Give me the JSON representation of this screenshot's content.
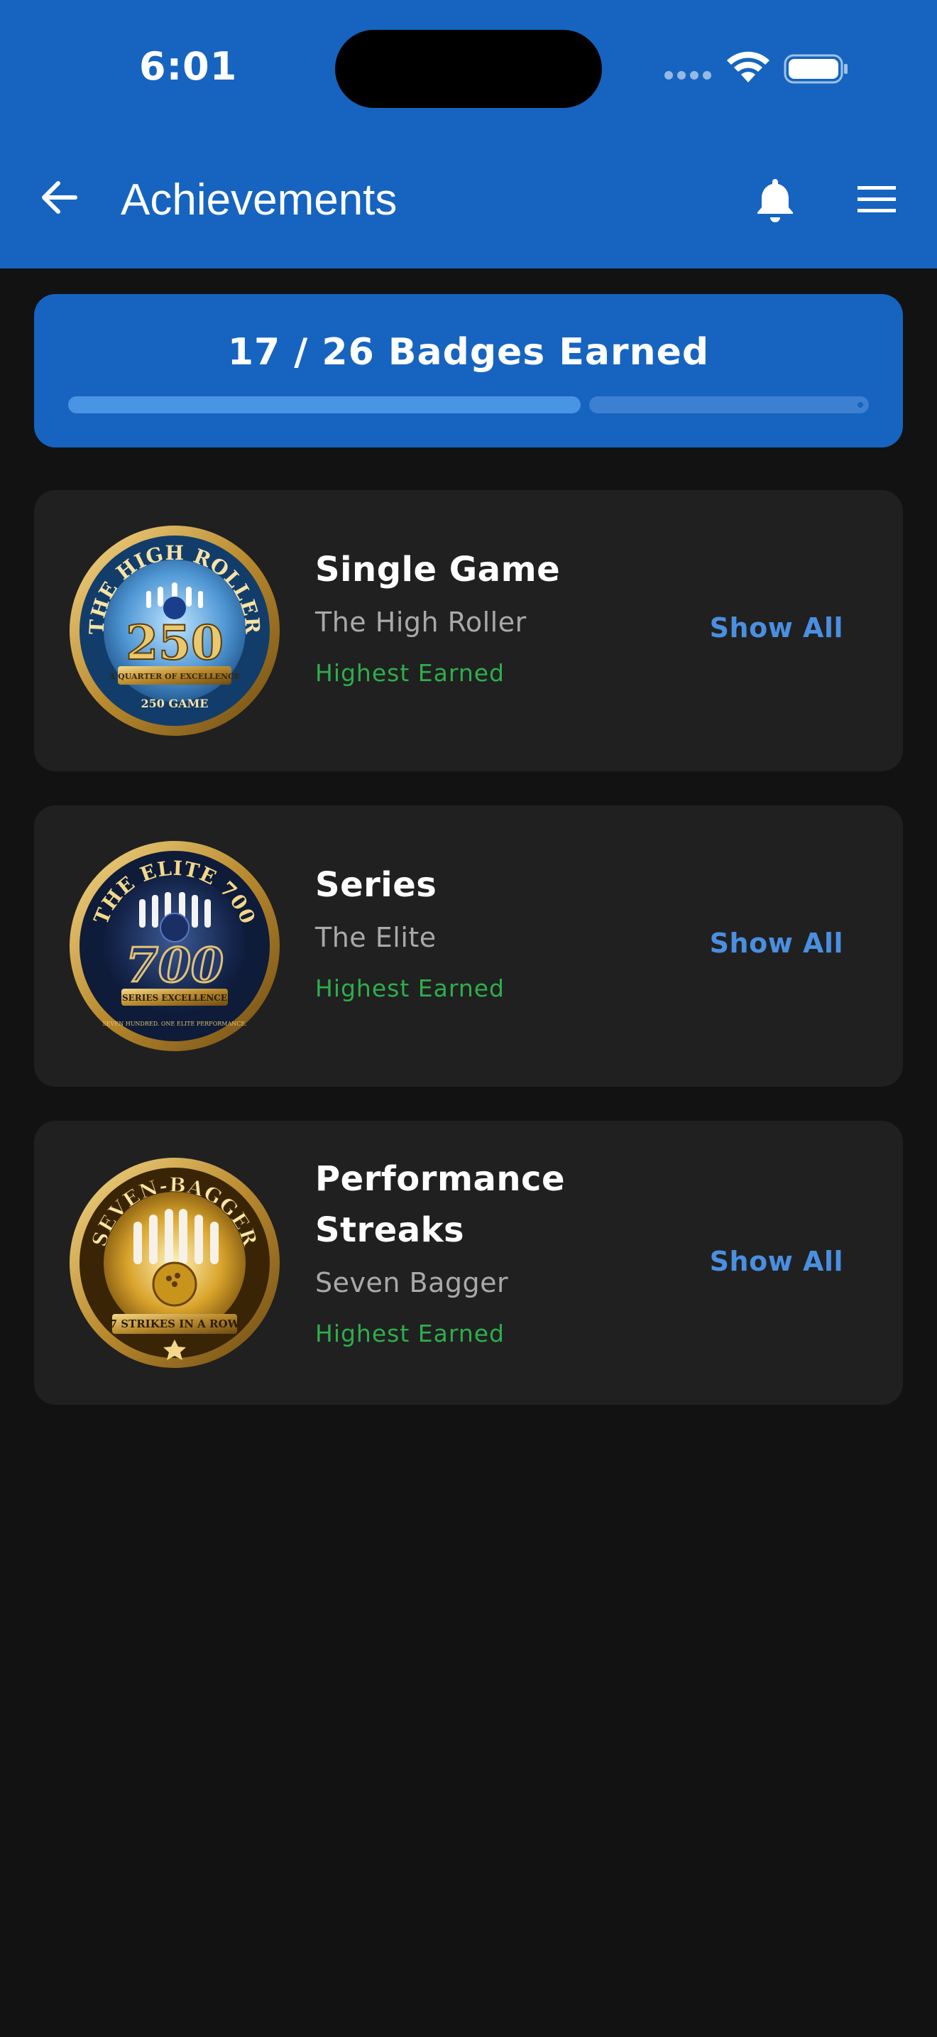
{
  "status_bar": {
    "time": "6:01"
  },
  "header": {
    "title": "Achievements"
  },
  "progress": {
    "label": "17 / 26 Badges Earned",
    "earned": 17,
    "total": 26
  },
  "categories": [
    {
      "title": "Single Game",
      "badge_name": "The High Roller",
      "status": "Highest Earned",
      "action": "Show All",
      "badge": {
        "arc_text": "THE HIGH ROLLER",
        "number": "250",
        "banner": "A QUARTER OF EXCELLENCE",
        "footer": "250 GAME"
      }
    },
    {
      "title": "Series",
      "badge_name": "The Elite",
      "status": "Highest Earned",
      "action": "Show All",
      "badge": {
        "arc_text": "THE ELITE 700",
        "number": "700",
        "banner": "SERIES EXCELLENCE",
        "footer": "SEVEN HUNDRED. ONE ELITE PERFORMANCE."
      }
    },
    {
      "title": "Performance Streaks",
      "badge_name": "Seven Bagger",
      "status": "Highest Earned",
      "action": "Show All",
      "badge": {
        "arc_text": "SEVEN-BAGGER",
        "banner": "7 STRIKES IN A ROW"
      }
    }
  ],
  "colors": {
    "primary": "#1664c0",
    "background": "#121212",
    "card": "#202020",
    "accent_link": "#4a8fe0",
    "success": "#2eae4c",
    "muted_text": "#a9a9a9"
  },
  "icons": [
    "back-arrow-icon",
    "bell-icon",
    "hamburger-menu-icon",
    "wifi-icon",
    "battery-icon",
    "signal-icon"
  ]
}
